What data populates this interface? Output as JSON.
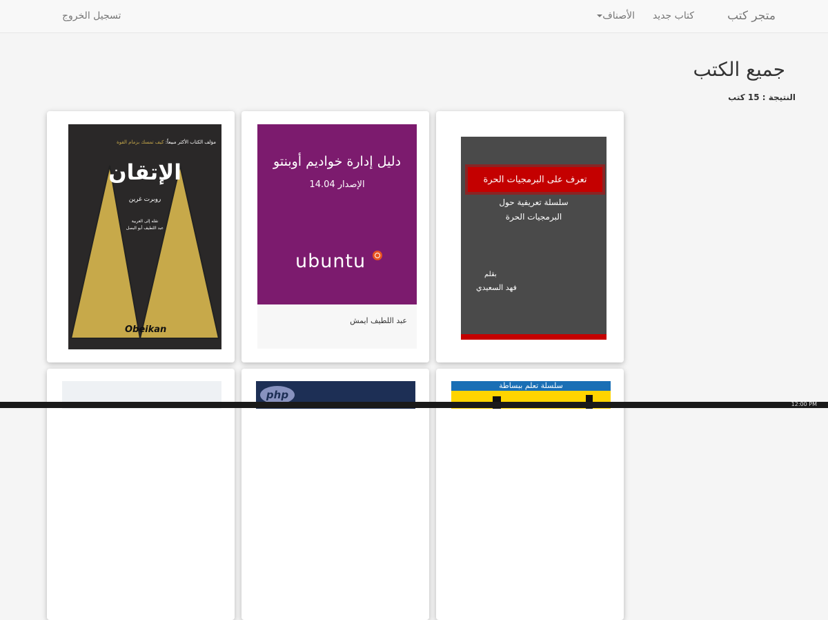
{
  "navbar": {
    "brand": "متجر كتب",
    "new_book": "كتاب جديد",
    "categories": "الأصناف",
    "logout": "تسجيل الخروج"
  },
  "page": {
    "title": "جميع الكتب",
    "result": "النتيجة : 15 كتب"
  },
  "books": [
    {
      "cover_title": "تعرف على البرمجيات الحرة",
      "cover_subtitle_1": "سلسلة تعريفية حول",
      "cover_subtitle_2": "البرمجيات الحرة",
      "cover_by": "بقلم",
      "cover_author": "فهد السعيدي",
      "cover_color": "#4a4a4a",
      "accent_color": "#c40000"
    },
    {
      "cover_title": "دليل إدارة خواديم أوبنتو",
      "cover_edition": "الإصدار 14.04",
      "cover_logo": "ubuntu",
      "author": "عبد اللطيف ايمش",
      "cover_color": "#7c1b6e"
    },
    {
      "cover_blurb_prefix": "مؤلف الكتاب الأكثر مبيعاً:",
      "cover_blurb_highlight": "كيف تمسك بزمام القوة",
      "cover_title": "الإتقان",
      "cover_author": "روبرت غرين",
      "cover_translation_1": "نقله إلى العربية",
      "cover_translation_2": "عبد اللطيف أبو البصل",
      "cover_publisher": "Obeikan",
      "cover_color": "#2a2828",
      "accent_color": "#c7a94a"
    }
  ],
  "row2": {
    "book1_band": "سلسلة تعلم ببساطة",
    "book2_logo": "php"
  },
  "taskbar": {
    "clock": "12:00 PM"
  }
}
